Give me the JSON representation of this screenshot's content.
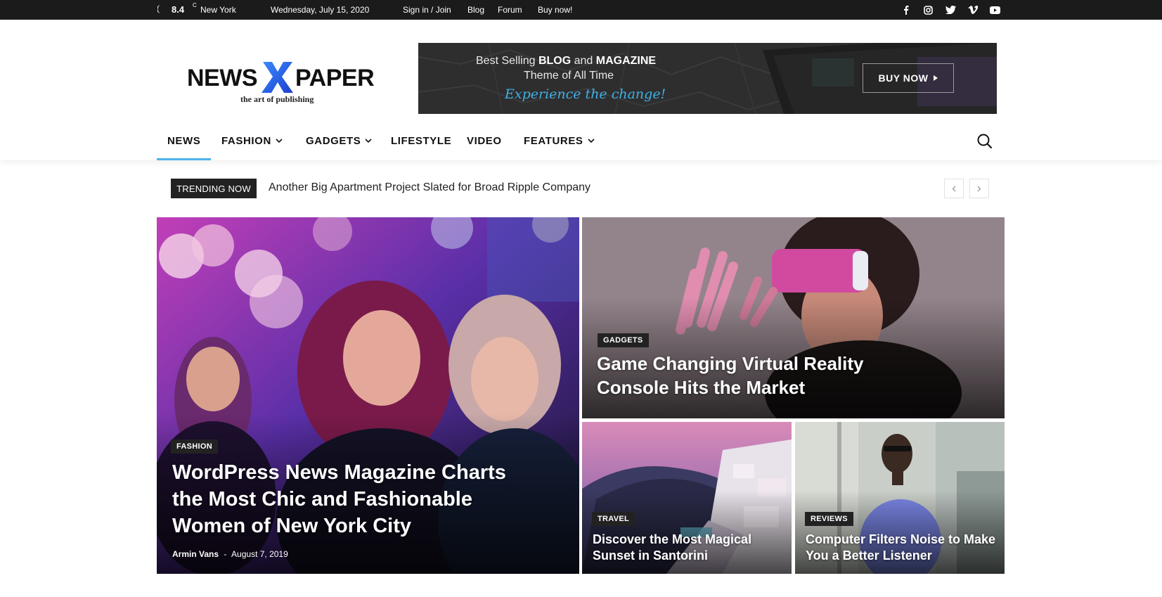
{
  "topbar": {
    "temperature": "8.4",
    "temp_unit": "C",
    "city": "New York",
    "date": "Wednesday, July 15, 2020",
    "links": [
      "Sign in / Join",
      "Blog",
      "Forum",
      "Buy now!"
    ],
    "social": [
      "facebook-icon",
      "instagram-icon",
      "twitter-icon",
      "vimeo-icon",
      "youtube-icon"
    ]
  },
  "logo": {
    "word1": "NEWS",
    "mark": "X",
    "word2": "PAPER",
    "tagline": "the art of publishing"
  },
  "banner": {
    "line1_pre": "Best Selling ",
    "line1_blog": "BLOG",
    "line1_mid": " and ",
    "line1_mag": "MAGAZINE",
    "line2": "Theme of All Time",
    "line3": "Experience the change!",
    "button": "BUY NOW"
  },
  "nav": {
    "items": [
      {
        "label": "NEWS",
        "dropdown": false
      },
      {
        "label": "FASHION",
        "dropdown": true
      },
      {
        "label": "GADGETS",
        "dropdown": true
      },
      {
        "label": "LIFESTYLE",
        "dropdown": false
      },
      {
        "label": "VIDEO",
        "dropdown": false
      },
      {
        "label": "FEATURES",
        "dropdown": true
      }
    ]
  },
  "trending": {
    "label": "TRENDING NOW",
    "headline": "Another Big Apartment Project Slated for Broad Ripple Company"
  },
  "articles": {
    "main": {
      "category": "FASHION",
      "title_lines": [
        "WordPress News Magazine Charts",
        "the Most Chic and Fashionable",
        "Women of New York City"
      ],
      "author": "Armin Vans",
      "separator": "-",
      "date": "August 7, 2019"
    },
    "top_right": {
      "category": "GADGETS",
      "title_lines": [
        "Game Changing Virtual Reality",
        "Console Hits the Market"
      ]
    },
    "bottom_left": {
      "category": "TRAVEL",
      "title_lines": [
        "Discover the Most Magical",
        "Sunset in Santorini"
      ]
    },
    "bottom_right": {
      "category": "REVIEWS",
      "title_lines": [
        "Computer Filters Noise to Make",
        "You a Better Listener"
      ]
    }
  },
  "colors": {
    "accent": "#4db2ec",
    "topbar_bg": "#1b1b1b",
    "logo_mark": "#2f6fe8",
    "banner_link": "#3fb1e6"
  }
}
